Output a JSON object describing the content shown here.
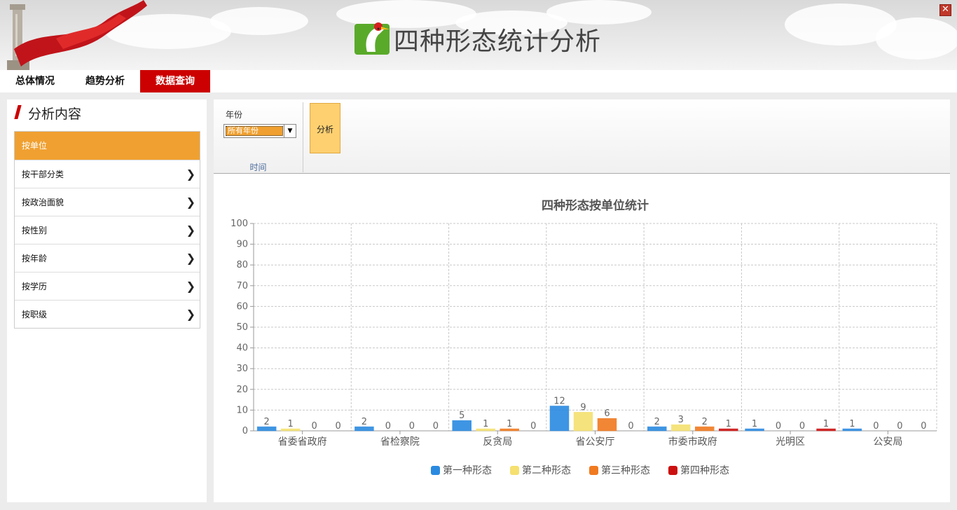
{
  "app": {
    "title": "四种形态统计分析",
    "close_label": "✕"
  },
  "nav": {
    "tabs": [
      {
        "label": "总体情况"
      },
      {
        "label": "趋势分析"
      },
      {
        "label": "数据查询"
      }
    ],
    "active": 2
  },
  "sidebar": {
    "title": "分析内容",
    "items": [
      {
        "label": "按单位"
      },
      {
        "label": "按干部分类"
      },
      {
        "label": "按政治面貌"
      },
      {
        "label": "按性别"
      },
      {
        "label": "按年龄"
      },
      {
        "label": "按学历"
      },
      {
        "label": "按职级"
      }
    ],
    "active": 0
  },
  "toolbar": {
    "year_label": "年份",
    "year_value": "所有年份",
    "group_label": "时间",
    "analyze_label": "分析"
  },
  "colors": {
    "accent_red": "#cc0000",
    "accent_orange": "#f0a030"
  },
  "chart_data": {
    "type": "bar",
    "title": "四种形态按单位统计",
    "categories": [
      "省委省政府",
      "省检察院",
      "反贪局",
      "省公安厅",
      "市委市政府",
      "光明区",
      "公安局"
    ],
    "series": [
      {
        "name": "第一种形态",
        "color": "#2a8ae0",
        "values": [
          2,
          2,
          5,
          12,
          2,
          1,
          1
        ]
      },
      {
        "name": "第二种形态",
        "color": "#f5e070",
        "values": [
          1,
          0,
          1,
          9,
          3,
          0,
          0
        ]
      },
      {
        "name": "第三种形态",
        "color": "#f07a20",
        "values": [
          0,
          0,
          1,
          6,
          2,
          0,
          0
        ]
      },
      {
        "name": "第四种形态",
        "color": "#cc1010",
        "values": [
          0,
          0,
          0,
          0,
          1,
          1,
          0
        ]
      }
    ],
    "ylim": [
      0,
      100
    ],
    "yticks": [
      0,
      10,
      20,
      30,
      40,
      50,
      60,
      70,
      80,
      90,
      100
    ],
    "grid": true,
    "legend": "bottom"
  }
}
